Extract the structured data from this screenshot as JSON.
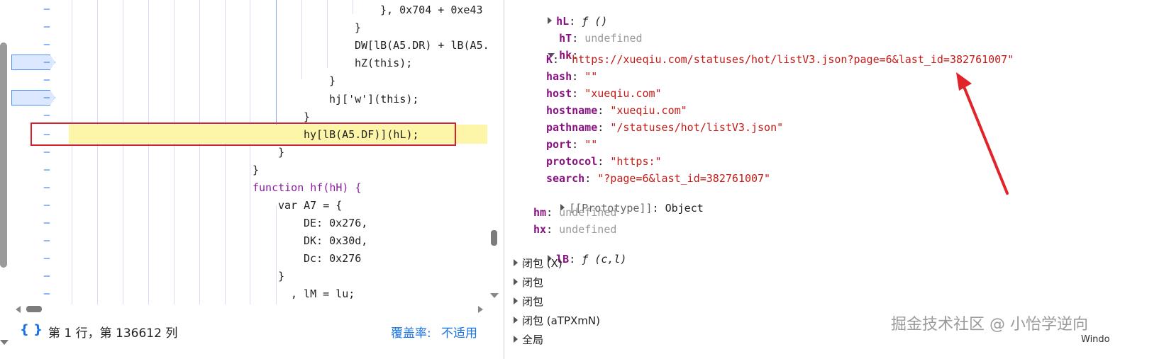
{
  "editor": {
    "code_lines": [
      "}, 0x704 + 0xe43",
      "}",
      "DW[lB(A5.DR) + lB(A5.",
      "hZ(this);",
      "}",
      "hj['w'](this);",
      "}",
      "hy[lB(A5.DF)](hL);",
      "}",
      "}",
      "function hf(hH) {",
      "var A7 = {",
      "DE: 0x276,",
      "DK: 0x30d,",
      "Dc: 0x276",
      "}",
      ", lM = lu;"
    ],
    "gutter_marker": "–",
    "status": {
      "position": "第 1 行，第 136612 列",
      "coverage_label": "覆盖率:",
      "coverage_value": "不适用"
    }
  },
  "scope": {
    "hL": {
      "key": "hL",
      "value": "ƒ ()"
    },
    "hT": {
      "key": "hT",
      "value": "undefined"
    },
    "hk": {
      "key": "hk",
      "props": [
        {
          "key": "K",
          "value": "\"https://xueqiu.com/statuses/hot/listV3.json?page=6&last_id=382761007\""
        },
        {
          "key": "hash",
          "value": "\"\""
        },
        {
          "key": "host",
          "value": "\"xueqiu.com\""
        },
        {
          "key": "hostname",
          "value": "\"xueqiu.com\""
        },
        {
          "key": "pathname",
          "value": "\"/statuses/hot/listV3.json\""
        },
        {
          "key": "port",
          "value": "\"\""
        },
        {
          "key": "protocol",
          "value": "\"https:\""
        },
        {
          "key": "search",
          "value": "\"?page=6&last_id=382761007\""
        }
      ],
      "prototype": {
        "key": "[[Prototype]]",
        "value": "Object"
      }
    },
    "hm": {
      "key": "hm",
      "value": "undefined"
    },
    "hx": {
      "key": "hx",
      "value": "undefined"
    },
    "lB": {
      "key": "lB",
      "value": "ƒ (c,l)"
    },
    "closures": [
      "闭包 (X)",
      "闭包",
      "闭包",
      "闭包 (aTPXmN)",
      "全局"
    ]
  },
  "watermark": "掘金技术社区 @ 小怡学逆向",
  "window_fragment": "Windo",
  "colors": {
    "highlight": "#fdf5a8",
    "red_box": "#d6202a",
    "accent": "#1a73e8",
    "arrow": "#e0242a"
  }
}
